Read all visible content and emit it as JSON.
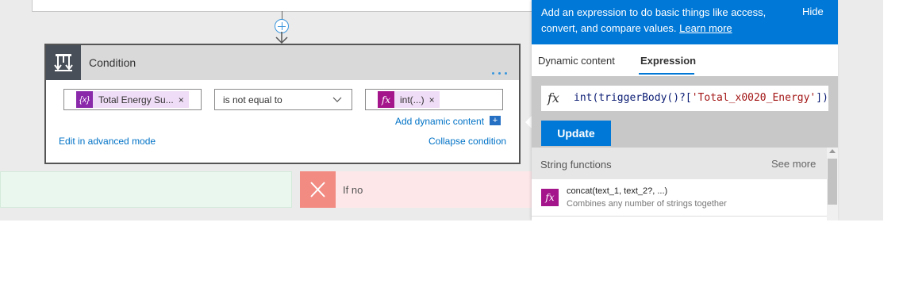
{
  "condition": {
    "title": "Condition",
    "left_token": {
      "label": "Total Energy Su...",
      "icon": "variable-icon",
      "remove": "×"
    },
    "operator": {
      "selected": "is not equal to"
    },
    "right_token": {
      "label": "int(...)",
      "icon": "fx-icon",
      "remove": "×"
    },
    "add_dynamic": "Add dynamic content",
    "add_dynamic_badge": "+",
    "edit_advanced": "Edit in advanced mode",
    "collapse": "Collapse condition"
  },
  "branches": {
    "if_no": "If no"
  },
  "panel": {
    "description": "Add an expression to do basic things like access, convert, and compare values.",
    "learn_more": "Learn more",
    "hide": "Hide",
    "tabs": [
      {
        "label": "Dynamic content",
        "active": false
      },
      {
        "label": "Expression",
        "active": true
      }
    ],
    "expression": {
      "prefix": "int(triggerBody()?[",
      "string": "'Total_x0020_Energy'",
      "suffix": "])"
    },
    "update_button": "Update",
    "functions": {
      "header": "String functions",
      "see_more": "See more",
      "items": [
        {
          "name": "concat(text_1, text_2?, ...)",
          "description": "Combines any number of strings together"
        }
      ]
    }
  },
  "colors": {
    "accent": "#0078d7",
    "token_variable": "#8a2aab",
    "token_function": "#a4148b",
    "if_no": "#f28b82"
  }
}
